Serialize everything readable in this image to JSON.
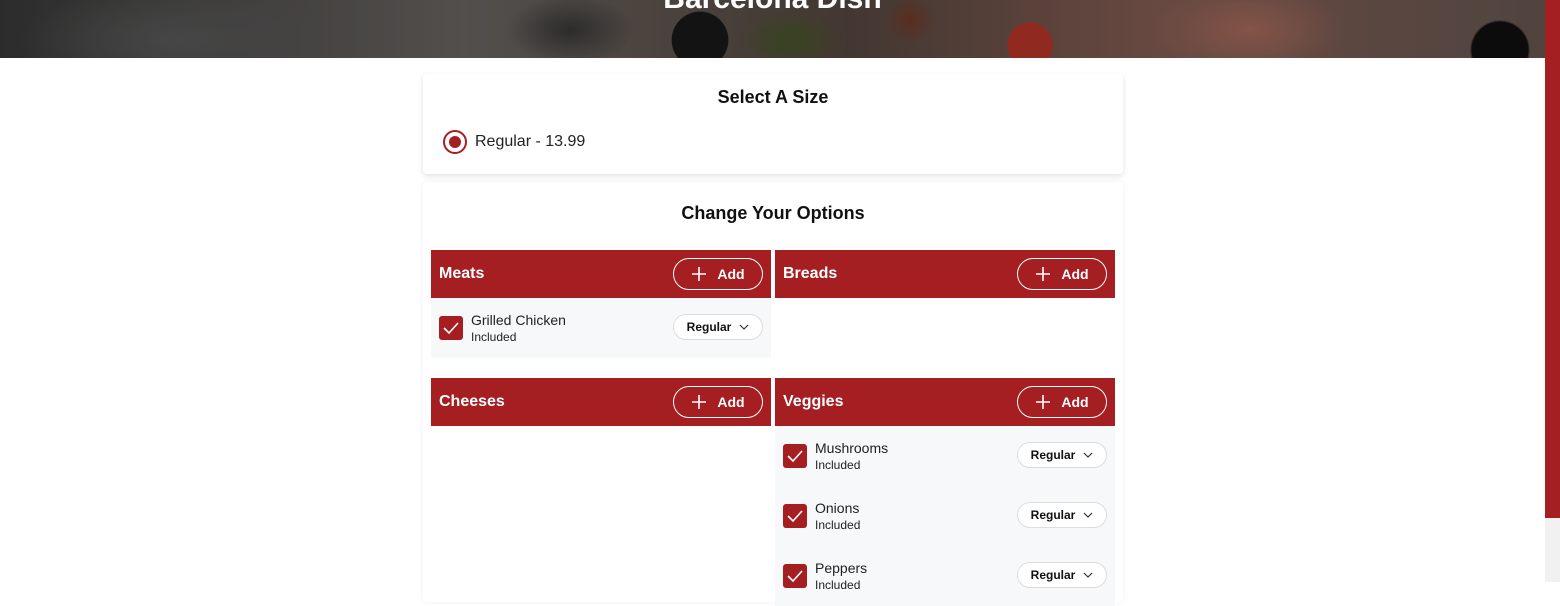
{
  "hero": {
    "title": "Barcelona Dish"
  },
  "size": {
    "title": "Select A Size",
    "options": [
      {
        "label": "Regular - 13.99",
        "selected": true
      }
    ]
  },
  "options": {
    "title": "Change Your Options",
    "add_label": "Add",
    "groups": {
      "meats": {
        "name": "Meats",
        "items": [
          {
            "name": "Grilled Chicken",
            "status": "Included",
            "portion": "Regular",
            "checked": true
          }
        ]
      },
      "breads": {
        "name": "Breads",
        "items": []
      },
      "cheeses": {
        "name": "Cheeses",
        "items": []
      },
      "veggies": {
        "name": "Veggies",
        "items": [
          {
            "name": "Mushrooms",
            "status": "Included",
            "portion": "Regular",
            "checked": true
          },
          {
            "name": "Onions",
            "status": "Included",
            "portion": "Regular",
            "checked": true
          },
          {
            "name": "Peppers",
            "status": "Included",
            "portion": "Regular",
            "checked": true
          }
        ]
      }
    }
  },
  "colors": {
    "accent": "#a51e22",
    "item_bg": "#f7f8fa"
  }
}
